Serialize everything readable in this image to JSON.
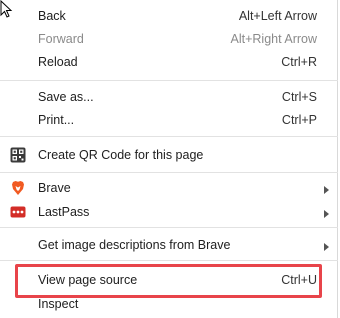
{
  "menu": {
    "items": [
      {
        "label": "Back",
        "shortcut": "Alt+Left Arrow"
      },
      {
        "label": "Forward",
        "shortcut": "Alt+Right Arrow",
        "disabled": true
      },
      {
        "label": "Reload",
        "shortcut": "Ctrl+R"
      },
      {
        "label": "Save as...",
        "shortcut": "Ctrl+S"
      },
      {
        "label": "Print...",
        "shortcut": "Ctrl+P"
      },
      {
        "label": "Create QR Code for this page",
        "icon": "qr-code-icon"
      },
      {
        "label": "Brave",
        "icon": "brave-lion-icon",
        "submenu": true
      },
      {
        "label": "LastPass",
        "icon": "lastpass-icon",
        "submenu": true
      },
      {
        "label": "Get image descriptions from Brave",
        "submenu": true
      },
      {
        "label": "View page source",
        "shortcut": "Ctrl+U",
        "highlighted": true
      },
      {
        "label": "Inspect"
      }
    ]
  },
  "colors": {
    "highlight_border": "#e8444a",
    "brave_orange": "#f15a22",
    "lastpass_red": "#d32d27",
    "disabled_text": "#8a8a8a"
  }
}
